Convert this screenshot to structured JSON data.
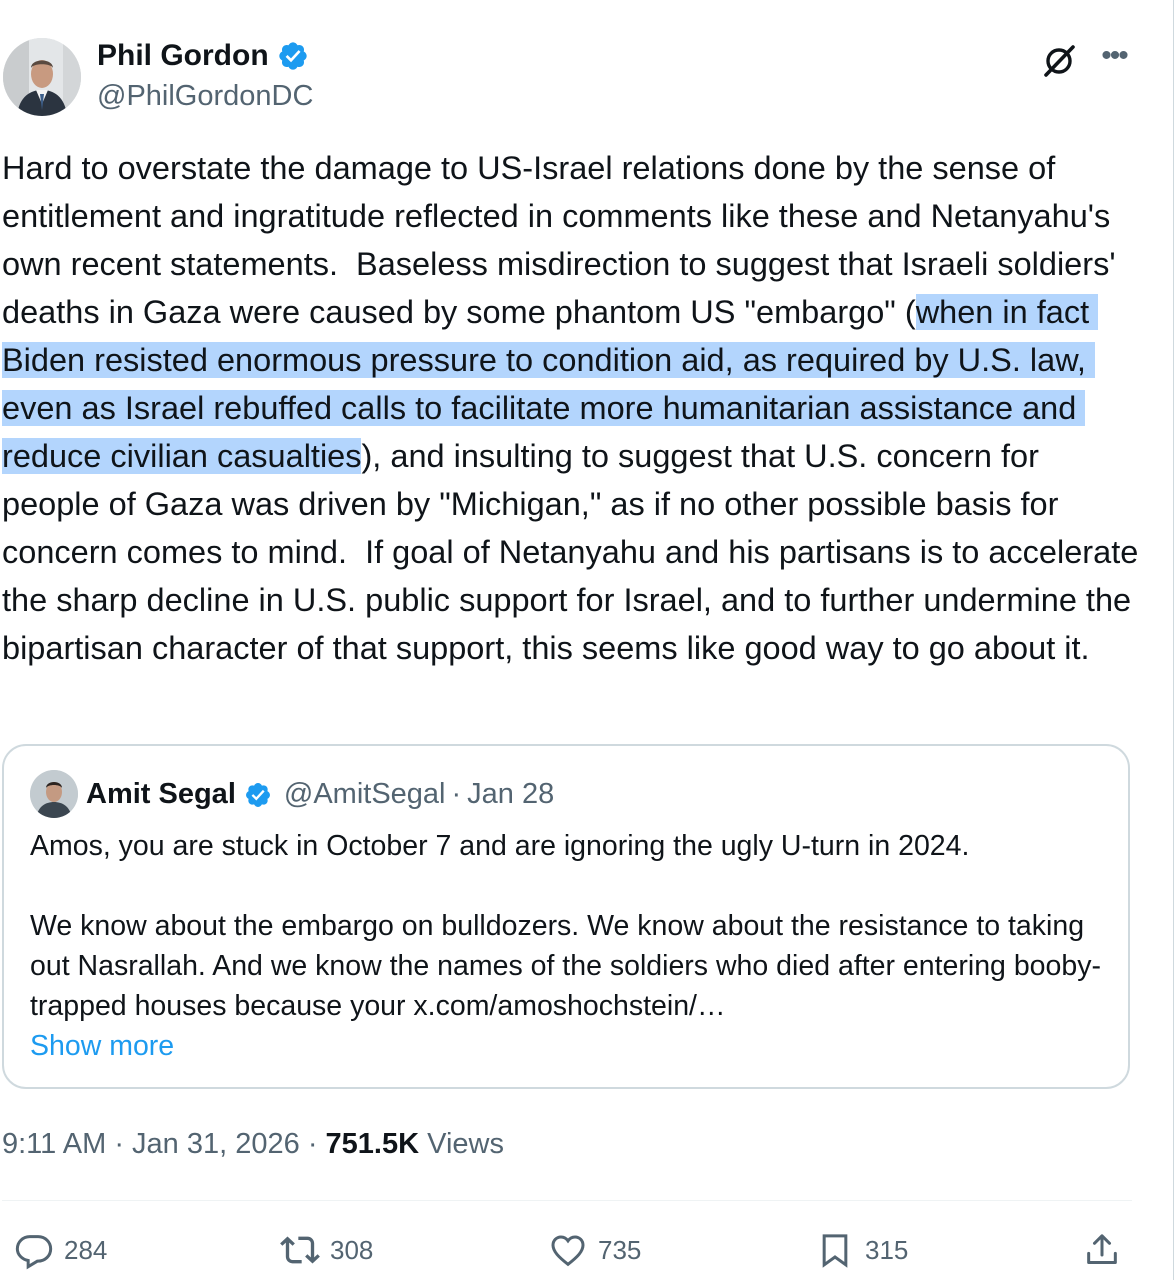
{
  "author": {
    "name": "Phil Gordon",
    "handle": "@PhilGordonDC",
    "verified": true,
    "avatar_icon": "avatar-photo"
  },
  "post": {
    "text_before": "Hard to overstate the damage to US-Israel relations done by the sense of entitlement and ingratitude reflected in comments like these and Netanyahu's own recent statements.  Baseless misdirection to suggest that Israeli soldiers' deaths in Gaza were caused by some phantom US \"embargo\" (",
    "text_highlighted": "when in fact Biden resisted enormous pressure to condition aid, as required by U.S. law, even as Israel rebuffed calls to facilitate more humanitarian assistance and reduce civilian casualties",
    "text_after": "), and insulting to suggest that U.S. concern for people of Gaza was driven by \"Michigan,\" as if no other possible basis for concern comes to mind.  If goal of Netanyahu and his partisans is to accelerate the sharp decline in U.S. public support for Israel, and to further undermine the bipartisan character of that support, this seems like good way to go about it."
  },
  "quote": {
    "name": "Amit Segal",
    "handle": "@AmitSegal",
    "separator": "·",
    "date": "Jan 28",
    "text": "Amos, you are stuck in October 7 and are ignoring the ugly U-turn in 2024.\n\nWe know about the embargo on bulldozers. We know about the resistance to taking out Nasrallah. And we know the names of the soldiers who died after entering booby-trapped houses because your x.com/amoshochstein/…",
    "show_more": "Show more"
  },
  "meta": {
    "time": "9:11 AM",
    "sep1": "·",
    "date": "Jan 31, 2026",
    "sep2": "·",
    "views_count": "751.5K",
    "views_label": "Views"
  },
  "actions": {
    "replies": "284",
    "reposts": "308",
    "likes": "735",
    "bookmarks": "315"
  },
  "colors": {
    "accent": "#1d9bf0",
    "highlight": "#b3d5fd",
    "muted": "#536471",
    "text": "#0f1419"
  }
}
